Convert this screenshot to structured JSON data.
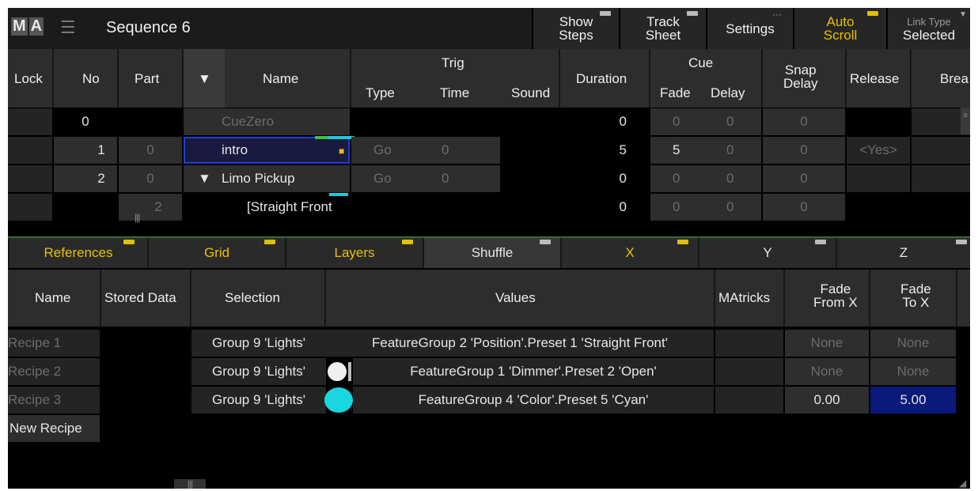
{
  "titlebar": {
    "logo": [
      "M",
      "A"
    ],
    "menu_icon": "list-menu-icon",
    "title": "Sequence 6",
    "buttons": [
      {
        "line1": "Show",
        "line2": "Steps"
      },
      {
        "line1": "Track",
        "line2": "Sheet"
      },
      {
        "line1": "Settings",
        "line2": ""
      },
      {
        "line1": "Auto",
        "line2": "Scroll"
      },
      {
        "line1": "Link Type",
        "line2": "Selected"
      }
    ]
  },
  "sequence": {
    "headers": {
      "lock": "Lock",
      "no": "No",
      "part": "Part",
      "filter": "▼",
      "name": "Name",
      "trig": "Trig",
      "type": "Type",
      "time": "Time",
      "sound": "Sound",
      "duration": "Duration",
      "cue": "Cue",
      "fade": "Fade",
      "delay": "Delay",
      "snap_line1": "Snap",
      "snap_line2": "Delay",
      "release": "Release",
      "break": "Brea"
    },
    "rows": [
      {
        "no": "0",
        "part": "",
        "arrow": "",
        "name": "CueZero",
        "type": "",
        "time": "",
        "duration": "0",
        "fade": "0",
        "delay": "0",
        "snap": "0",
        "release": ""
      },
      {
        "no": "1",
        "part": "0",
        "arrow": "",
        "name": "intro",
        "type": "Go",
        "time": "0",
        "duration": "5",
        "fade": "5",
        "delay": "0",
        "snap": "0",
        "release": "<Yes>"
      },
      {
        "no": "2",
        "part": "0",
        "arrow": "▼",
        "name": "Limo  Pickup",
        "type": "Go",
        "time": "0",
        "duration": "0",
        "fade": "0",
        "delay": "0",
        "snap": "0",
        "release": ""
      },
      {
        "no": "",
        "part": "2",
        "arrow": "",
        "name": "[Straight  Front",
        "type": "",
        "time": "",
        "duration": "0",
        "fade": "0",
        "delay": "0",
        "snap": "0",
        "release": ""
      }
    ]
  },
  "recipe_tabs": [
    "References",
    "Grid",
    "Layers",
    "Shuffle",
    "X",
    "Y",
    "Z"
  ],
  "recipes": {
    "headers": {
      "name": "Name",
      "stored": "Stored Data",
      "selection": "Selection",
      "values": "Values",
      "matricks": "MAtricks",
      "fade_from_1": "Fade",
      "fade_from_2": "From X",
      "fade_to_1": "Fade",
      "fade_to_2": "To X"
    },
    "rows": [
      {
        "name": "Recipe 1",
        "selection": "Group 9 'Lights'",
        "values": "FeatureGroup 2 'Position'.Preset 1 'Straight Front'",
        "fade_from": "None",
        "fade_to": "None"
      },
      {
        "name": "Recipe 2",
        "selection": "Group 9 'Lights'",
        "values": "FeatureGroup 1 'Dimmer'.Preset 2 'Open'",
        "fade_from": "None",
        "fade_to": "None"
      },
      {
        "name": "Recipe 3",
        "selection": "Group 9 'Lights'",
        "values": "FeatureGroup 4 'Color'.Preset 5 'Cyan'",
        "fade_from": "0.00",
        "fade_to": "5.00"
      }
    ],
    "new_recipe": "New Recipe"
  },
  "colors": {
    "accent_yellow": "#e8c100",
    "cyan": "#19d6e0",
    "dimmer_white": "#f0f0f0",
    "selected_blue": "#0a1a7a"
  }
}
